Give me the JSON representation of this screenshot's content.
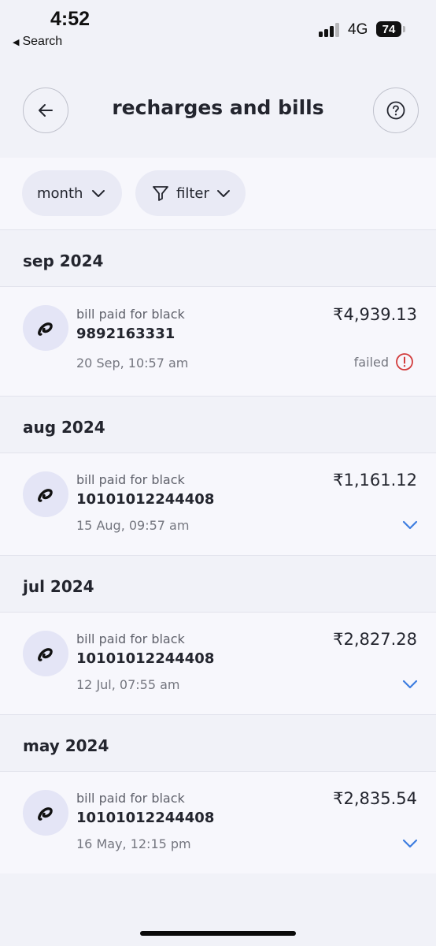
{
  "status_bar": {
    "time": "4:52",
    "back_label": "Search",
    "network": "4G",
    "battery": "74"
  },
  "header": {
    "title": "recharges and bills"
  },
  "filters": {
    "month_label": "month",
    "filter_label": "filter"
  },
  "sections": [
    {
      "label": "sep 2024",
      "transaction": {
        "title": "bill paid for black",
        "number": "9892163331",
        "date": "20 Sep, 10:57 am",
        "amount": "₹4,939.13",
        "status": "failed"
      }
    },
    {
      "label": "aug 2024",
      "transaction": {
        "title": "bill paid for black",
        "number": "10101012244408",
        "date": "15 Aug, 09:57 am",
        "amount": "₹1,161.12"
      }
    },
    {
      "label": "jul 2024",
      "transaction": {
        "title": "bill paid for black",
        "number": "10101012244408",
        "date": "12 Jul, 07:55 am",
        "amount": "₹2,827.28"
      }
    },
    {
      "label": "may 2024",
      "transaction": {
        "title": "bill paid for black",
        "number": "10101012244408",
        "date": "16 May, 12:15 pm",
        "amount": "₹2,835.54"
      }
    }
  ],
  "colors": {
    "page_background": "#f1f2f8",
    "card_background": "#f7f7fc",
    "chip_background": "#e9eaf5",
    "avatar_background": "#e4e5f6",
    "text_primary": "#23252e",
    "text_secondary": "#74767f",
    "failed_red": "#d23c3c",
    "accent_blue": "#3d7de0"
  },
  "icons": {
    "back": "arrow-left-icon",
    "help": "question-circle-icon",
    "month_dropdown": "chevron-down-icon",
    "filter": "funnel-icon",
    "status_failed": "exclamation-circle-icon",
    "expand": "chevron-down-icon",
    "biller_logo": "airtel-logo-icon"
  }
}
